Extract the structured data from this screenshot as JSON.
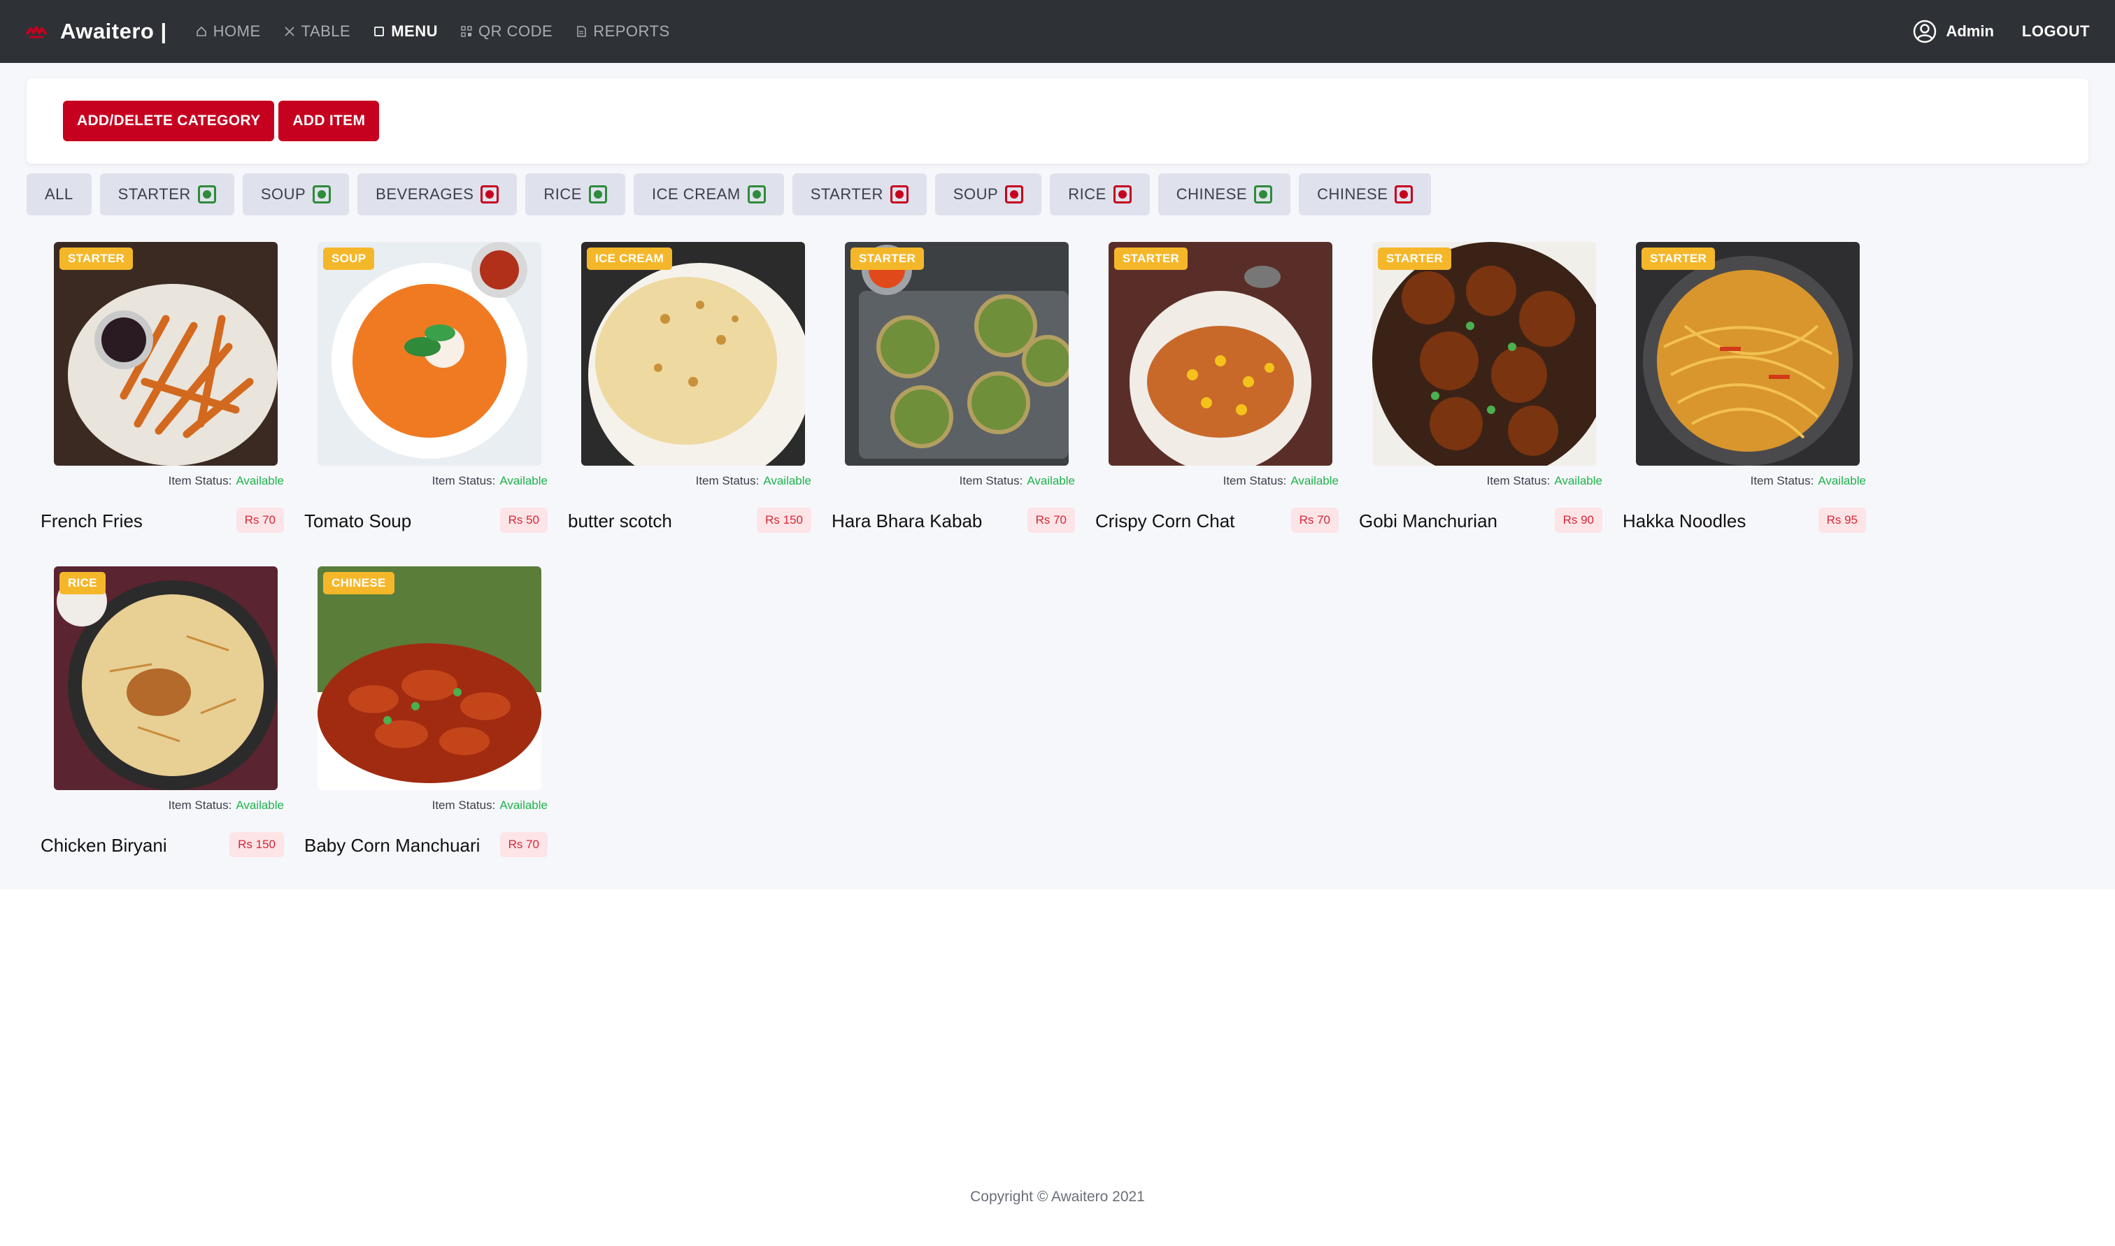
{
  "nav": {
    "brand": "Awaitero |",
    "links": [
      {
        "label": "HOME",
        "icon": "home-icon"
      },
      {
        "label": "TABLE",
        "icon": "cutlery-icon"
      },
      {
        "label": "MENU",
        "icon": "book-icon"
      },
      {
        "label": "QR CODE",
        "icon": "qr-icon"
      },
      {
        "label": "REPORTS",
        "icon": "report-icon"
      }
    ],
    "active": "MENU",
    "admin_label": "Admin",
    "logout_label": "LOGOUT"
  },
  "toolbar": {
    "add_delete_category": "ADD/DELETE CATEGORY",
    "add_item": "ADD ITEM"
  },
  "categories": [
    {
      "label": "ALL",
      "mark": "none"
    },
    {
      "label": "STARTER",
      "mark": "veg"
    },
    {
      "label": "SOUP",
      "mark": "veg"
    },
    {
      "label": "BEVERAGES",
      "mark": "nonveg"
    },
    {
      "label": "RICE",
      "mark": "veg"
    },
    {
      "label": "ICE CREAM",
      "mark": "veg"
    },
    {
      "label": "STARTER",
      "mark": "nonveg"
    },
    {
      "label": "SOUP",
      "mark": "nonveg"
    },
    {
      "label": "RICE",
      "mark": "nonveg"
    },
    {
      "label": "CHINESE",
      "mark": "veg"
    },
    {
      "label": "CHINESE",
      "mark": "nonveg"
    }
  ],
  "colors": {
    "veg": "#2e8b3a",
    "nonveg": "#c6001f",
    "accent": "#c6001f",
    "badge": "#f5b72a",
    "available": "#1db34a"
  },
  "status_label": "Item Status:",
  "items": [
    {
      "name": "French Fries",
      "category": "STARTER",
      "price": "Rs 70",
      "status": "Available"
    },
    {
      "name": "Tomato Soup",
      "category": "SOUP",
      "price": "Rs 50",
      "status": "Available"
    },
    {
      "name": "butter scotch",
      "category": "ICE CREAM",
      "price": "Rs 150",
      "status": "Available"
    },
    {
      "name": "Hara Bhara Kabab",
      "category": "STARTER",
      "price": "Rs 70",
      "status": "Available"
    },
    {
      "name": "Crispy Corn Chat",
      "category": "STARTER",
      "price": "Rs 70",
      "status": "Available"
    },
    {
      "name": "Gobi Manchurian",
      "category": "STARTER",
      "price": "Rs 90",
      "status": "Available"
    },
    {
      "name": "Hakka Noodles",
      "category": "STARTER",
      "price": "Rs 95",
      "status": "Available"
    },
    {
      "name": "Chicken Biryani",
      "category": "RICE",
      "price": "Rs 150",
      "status": "Available"
    },
    {
      "name": "Baby Corn Manchuari",
      "category": "CHINESE",
      "price": "Rs 70",
      "status": "Available"
    }
  ],
  "footer": "Copyright © Awaitero 2021"
}
